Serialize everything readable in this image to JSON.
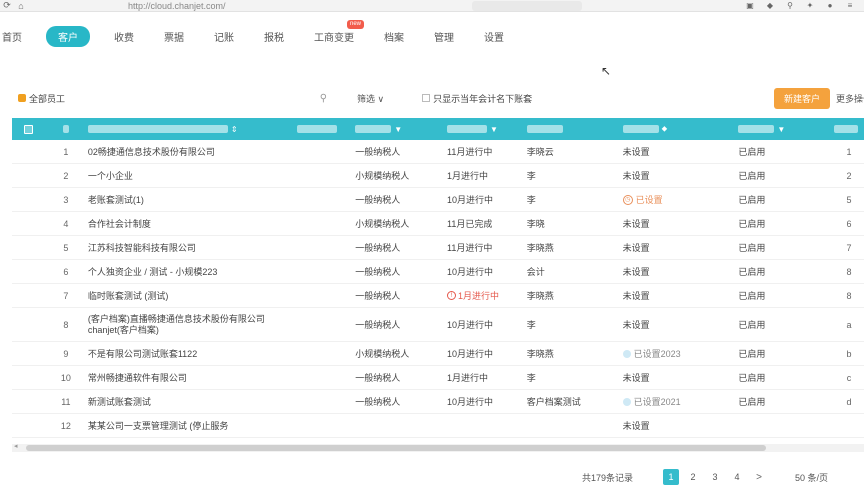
{
  "browser": {
    "url": "http://cloud.chanjet.com/",
    "url_extra": "",
    "search_placeholder": "",
    "icons": [
      "reload-icon",
      "home-icon",
      "profile-icon",
      "puzzle-icon",
      "search-icon",
      "settings-icon",
      "avatar-icon",
      "menu-icon"
    ]
  },
  "nav": {
    "first": "首页",
    "items": [
      "客户",
      "收费",
      "票据",
      "记账",
      "报税",
      "工商变更",
      "档案",
      "管理",
      "设置"
    ],
    "active_index": 0,
    "badge_index": 4,
    "badge_text": "new"
  },
  "toolbar": {
    "all_label": "全部员工",
    "search_placeholder": "",
    "filter_label": "筛选",
    "filter_caret": "∨",
    "check_label": "只显示当年会计名下账套",
    "new_button": "新建客户",
    "more_label": "更多操作"
  },
  "table": {
    "rows": [
      {
        "idx": "1",
        "name": "02畅捷通信息技术股份有限公司",
        "tag": "",
        "type": "一般纳税人",
        "period": "11月进行中",
        "period_warn": false,
        "acct": "李晓云",
        "setting": "未设置",
        "setting_kind": "none",
        "status": "已启用",
        "num": "1"
      },
      {
        "idx": "2",
        "name": "一个小企业",
        "tag": "",
        "type": "小规模纳税人",
        "period": "1月进行中",
        "period_warn": false,
        "acct": "李",
        "setting": "未设置",
        "setting_kind": "none",
        "status": "已启用",
        "num": "2"
      },
      {
        "idx": "3",
        "name": "老账套测试(1)",
        "tag": "",
        "type": "一般纳税人",
        "period": "10月进行中",
        "period_warn": false,
        "acct": "李",
        "setting": "已设置",
        "setting_kind": "warn",
        "status": "已启用",
        "num": "5"
      },
      {
        "idx": "4",
        "name": "合作社会计制度",
        "tag": "",
        "type": "小规模纳税人",
        "period": "11月已完成",
        "period_warn": false,
        "acct": "李晓",
        "setting": "未设置",
        "setting_kind": "none",
        "status": "已启用",
        "num": "6"
      },
      {
        "idx": "5",
        "name": "江苏科技智能科技有限公司",
        "tag": "",
        "type": "一般纳税人",
        "period": "11月进行中",
        "period_warn": false,
        "acct": "李晓燕",
        "setting": "未设置",
        "setting_kind": "none",
        "status": "已启用",
        "num": "7"
      },
      {
        "idx": "6",
        "name": "个人独资企业 / 测试 - 小规模223",
        "tag": "",
        "type": "一般纳税人",
        "period": "10月进行中",
        "period_warn": false,
        "acct": "会计",
        "setting": "未设置",
        "setting_kind": "none",
        "status": "已启用",
        "num": "8"
      },
      {
        "idx": "7",
        "name": "临时账套测试 (测试)",
        "tag": "",
        "type": "一般纳税人",
        "period": "1月进行中",
        "period_warn": true,
        "acct": "李晓燕",
        "setting": "未设置",
        "setting_kind": "none",
        "status": "已启用",
        "num": "8"
      },
      {
        "idx": "8",
        "name": "(客户档案)直播畅捷通信息技术股份有限公司chanjet(客户档案)",
        "tag": "",
        "type": "一般纳税人",
        "period": "10月进行中",
        "period_warn": false,
        "acct": "李",
        "setting": "未设置",
        "setting_kind": "none",
        "status": "已启用",
        "num": "a",
        "tall": true
      },
      {
        "idx": "9",
        "name": "不是有限公司测试账套1122",
        "tag": "",
        "type": "小规模纳税人",
        "period": "10月进行中",
        "period_warn": false,
        "acct": "李晓燕",
        "setting": "已设置2023",
        "setting_kind": "info",
        "status": "已启用",
        "num": "b"
      },
      {
        "idx": "10",
        "name": "常州畅捷通软件有限公司",
        "tag": "",
        "type": "一般纳税人",
        "period": "1月进行中",
        "period_warn": false,
        "acct": "李",
        "setting": "未设置",
        "setting_kind": "none",
        "status": "已启用",
        "num": "c"
      },
      {
        "idx": "11",
        "name": "新测试账套测试",
        "tag": "",
        "type": "一般纳税人",
        "period": "10月进行中",
        "period_warn": false,
        "acct": "客户档案测试",
        "setting": "已设置2021",
        "setting_kind": "info",
        "status": "已启用",
        "num": "d"
      },
      {
        "idx": "12",
        "name": "某某公司一支票管理测试 (停止服务",
        "tag": "",
        "type": "",
        "period": "",
        "period_warn": false,
        "acct": "",
        "setting": "未设置",
        "setting_kind": "none",
        "status": "",
        "num": ""
      }
    ]
  },
  "pager": {
    "total": "共179条记录",
    "pages": [
      "1",
      "2",
      "3",
      "4"
    ],
    "active": "1",
    "next": ">",
    "per_page": "50 条/页"
  }
}
